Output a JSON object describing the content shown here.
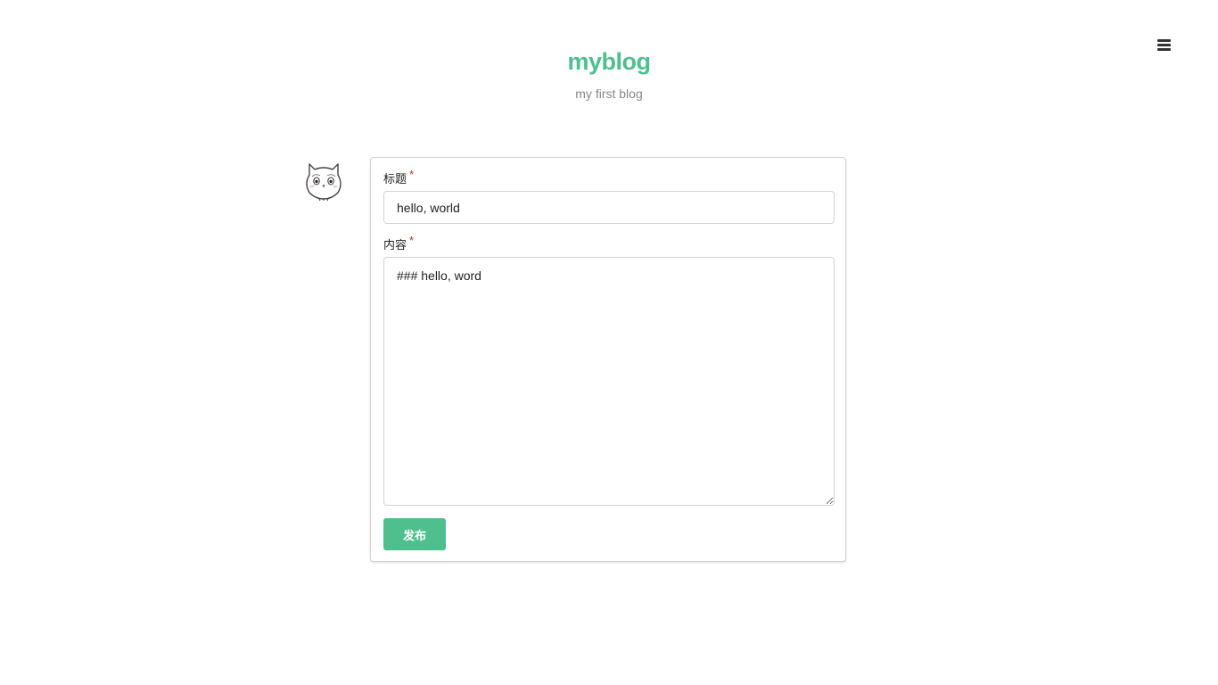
{
  "header": {
    "title": "myblog",
    "subtitle": "my first blog",
    "menu_icon": "hamburger-menu-icon"
  },
  "colors": {
    "brand": "#4fc08d",
    "required": "#db2828"
  },
  "avatar": {
    "icon": "owl-avatar"
  },
  "form": {
    "title_label": "标题",
    "title_required": "*",
    "title_value": "hello, world",
    "content_label": "内容",
    "content_required": "*",
    "content_value": "### hello, word",
    "submit_label": "发布"
  }
}
